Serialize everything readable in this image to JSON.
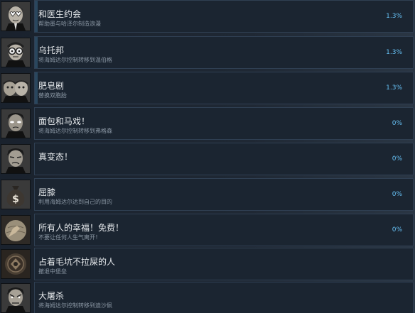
{
  "achievements": [
    {
      "title": "和医生约会",
      "description": "帮助墨与哈泽尔制造浪漫",
      "percent": "1.3%",
      "icon": "heart-eyes-face-icon"
    },
    {
      "title": "乌托邦",
      "description": "将海姆达尔控制转移到温伯格",
      "percent": "1.3%",
      "icon": "goggles-face-icon"
    },
    {
      "title": "肥皂剧",
      "description": "替换双胞胎",
      "percent": "1.3%",
      "icon": "twin-faces-icon"
    },
    {
      "title": "面包和马戏！",
      "description": "将海姆达尔控制转移到弗格森",
      "percent": "0%",
      "icon": "glowing-eyes-face-icon"
    },
    {
      "title": "真变态！",
      "description": "",
      "percent": "0%",
      "icon": "sneering-face-icon"
    },
    {
      "title": "屈膝",
      "description": "利用海姆达尔达到自己的目的",
      "percent": "0%",
      "icon": "money-bag-icon"
    },
    {
      "title": "所有人的幸福！免费！",
      "description": "不要让任何人生气离开！",
      "percent": "0%",
      "icon": "hand-on-globe-icon"
    },
    {
      "title": "占着毛坑不拉屎的人",
      "description": "撤退中堡垒",
      "percent": "",
      "icon": "chest-emblem-icon"
    },
    {
      "title": "大屠杀",
      "description": "将海姆达尔控制转移到迪沙佩",
      "percent": "",
      "icon": "angry-face-icon"
    }
  ]
}
